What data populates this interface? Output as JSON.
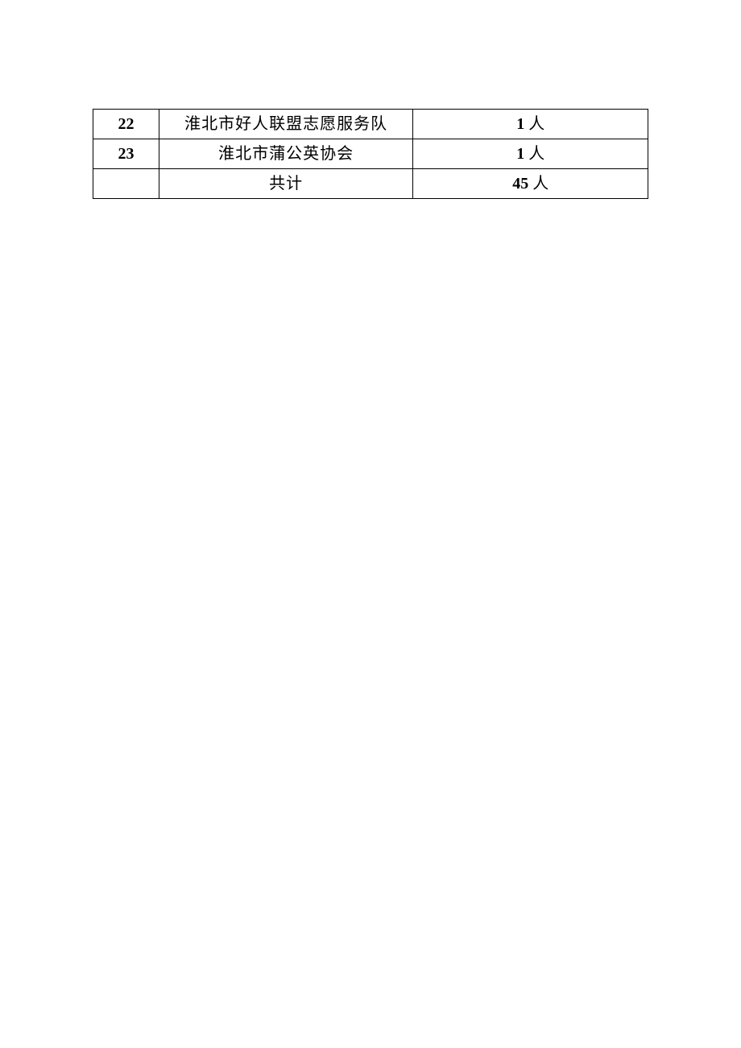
{
  "table": {
    "rows": [
      {
        "num": "22",
        "name": "淮北市好人联盟志愿服务队",
        "count_num": "1",
        "count_suffix": " 人"
      },
      {
        "num": "23",
        "name": "淮北市蒲公英协会",
        "count_num": "1",
        "count_suffix": " 人"
      },
      {
        "num": "",
        "name": "共计",
        "count_num": "45",
        "count_suffix": " 人"
      }
    ]
  }
}
